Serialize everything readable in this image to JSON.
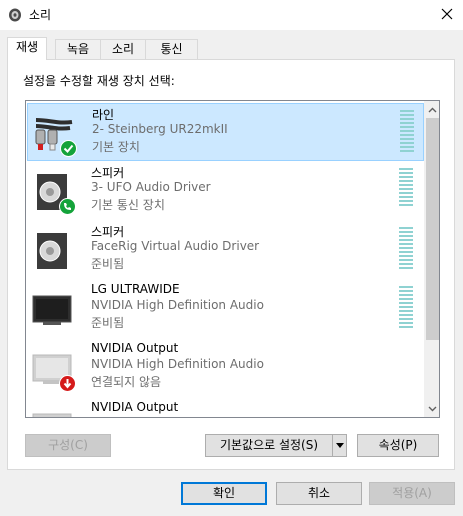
{
  "window": {
    "title": "소리",
    "icon": "speaker-icon",
    "close_icon": "close-icon"
  },
  "tabs": [
    {
      "label": "재생",
      "active": true
    },
    {
      "label": "녹음",
      "active": false
    },
    {
      "label": "소리",
      "active": false
    },
    {
      "label": "통신",
      "active": false
    }
  ],
  "panel": {
    "instruction": "설정을 수정할 재생 장치 선택:"
  },
  "devices": [
    {
      "name": "라인",
      "driver": "2- Steinberg UR22mkII",
      "status": "기본 장치",
      "icon": "line-cable-icon",
      "badge": "check-badge-icon",
      "selected": true
    },
    {
      "name": "스피커",
      "driver": "3- UFO Audio Driver",
      "status": "기본 통신 장치",
      "icon": "speaker-icon",
      "badge": "phone-badge-icon",
      "selected": false
    },
    {
      "name": "스피커",
      "driver": "FaceRig Virtual Audio Driver",
      "status": "준비됨",
      "icon": "speaker-icon",
      "selected": false
    },
    {
      "name": "LG ULTRAWIDE",
      "driver": "NVIDIA High Definition Audio",
      "status": "준비됨",
      "icon": "monitor-icon",
      "selected": false
    },
    {
      "name": "NVIDIA Output",
      "driver": "NVIDIA High Definition Audio",
      "status": "연결되지 않음",
      "icon": "monitor-icon",
      "badge": "down-arrow-badge-icon",
      "selected": false
    },
    {
      "name": "NVIDIA Output",
      "driver": "",
      "status": "",
      "icon": "monitor-icon",
      "selected": false
    }
  ],
  "buttons": {
    "configure": "구성(C)",
    "set_default": "기본값으로 설정(S)",
    "properties": "속성(P)",
    "ok": "확인",
    "cancel": "취소",
    "apply": "적용(A)"
  },
  "colors": {
    "selection_bg": "#cce8ff",
    "selection_border": "#99d1ff",
    "dialog_bg": "#f0f0f0",
    "accent": "#0078d7",
    "badge_green": "#14a33a",
    "badge_red": "#d51a1a"
  }
}
